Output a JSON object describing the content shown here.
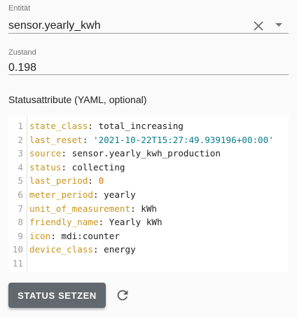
{
  "entity": {
    "label": "Entität",
    "value": "sensor.yearly_kwh",
    "clear_icon": "close-icon",
    "dropdown_icon": "arrow-drop-down-icon"
  },
  "state": {
    "label": "Zustand",
    "value": "0.198"
  },
  "attributes": {
    "title": "Statusattribute (YAML, optional)",
    "lines": [
      {
        "num": "1",
        "key": "state_class",
        "value": "total_increasing",
        "type": "plain"
      },
      {
        "num": "2",
        "key": "last_reset",
        "value": "'2021-10-22T15:27:49.939196+00:00'",
        "type": "string"
      },
      {
        "num": "3",
        "key": "source",
        "value": "sensor.yearly_kwh_production",
        "type": "plain"
      },
      {
        "num": "4",
        "key": "status",
        "value": "collecting",
        "type": "plain"
      },
      {
        "num": "5",
        "key": "last_period",
        "value": "0",
        "type": "number"
      },
      {
        "num": "6",
        "key": "meter_period",
        "value": "yearly",
        "type": "plain"
      },
      {
        "num": "7",
        "key": "unit_of_measurement",
        "value": "kWh",
        "type": "plain"
      },
      {
        "num": "8",
        "key": "friendly_name",
        "value": "Yearly kWh",
        "type": "plain"
      },
      {
        "num": "9",
        "key": "icon",
        "value": "mdi:counter",
        "type": "plain"
      },
      {
        "num": "10",
        "key": "device_class",
        "value": "energy",
        "type": "plain"
      },
      {
        "num": "11",
        "key": "",
        "value": "",
        "type": "empty"
      }
    ]
  },
  "actions": {
    "set_state_label": "STATUS SETZEN",
    "refresh_icon": "refresh-icon"
  },
  "colors": {
    "key": "#c8951e",
    "string": "#0b7d8a",
    "number": "#e06c00",
    "button": "#62686d"
  }
}
